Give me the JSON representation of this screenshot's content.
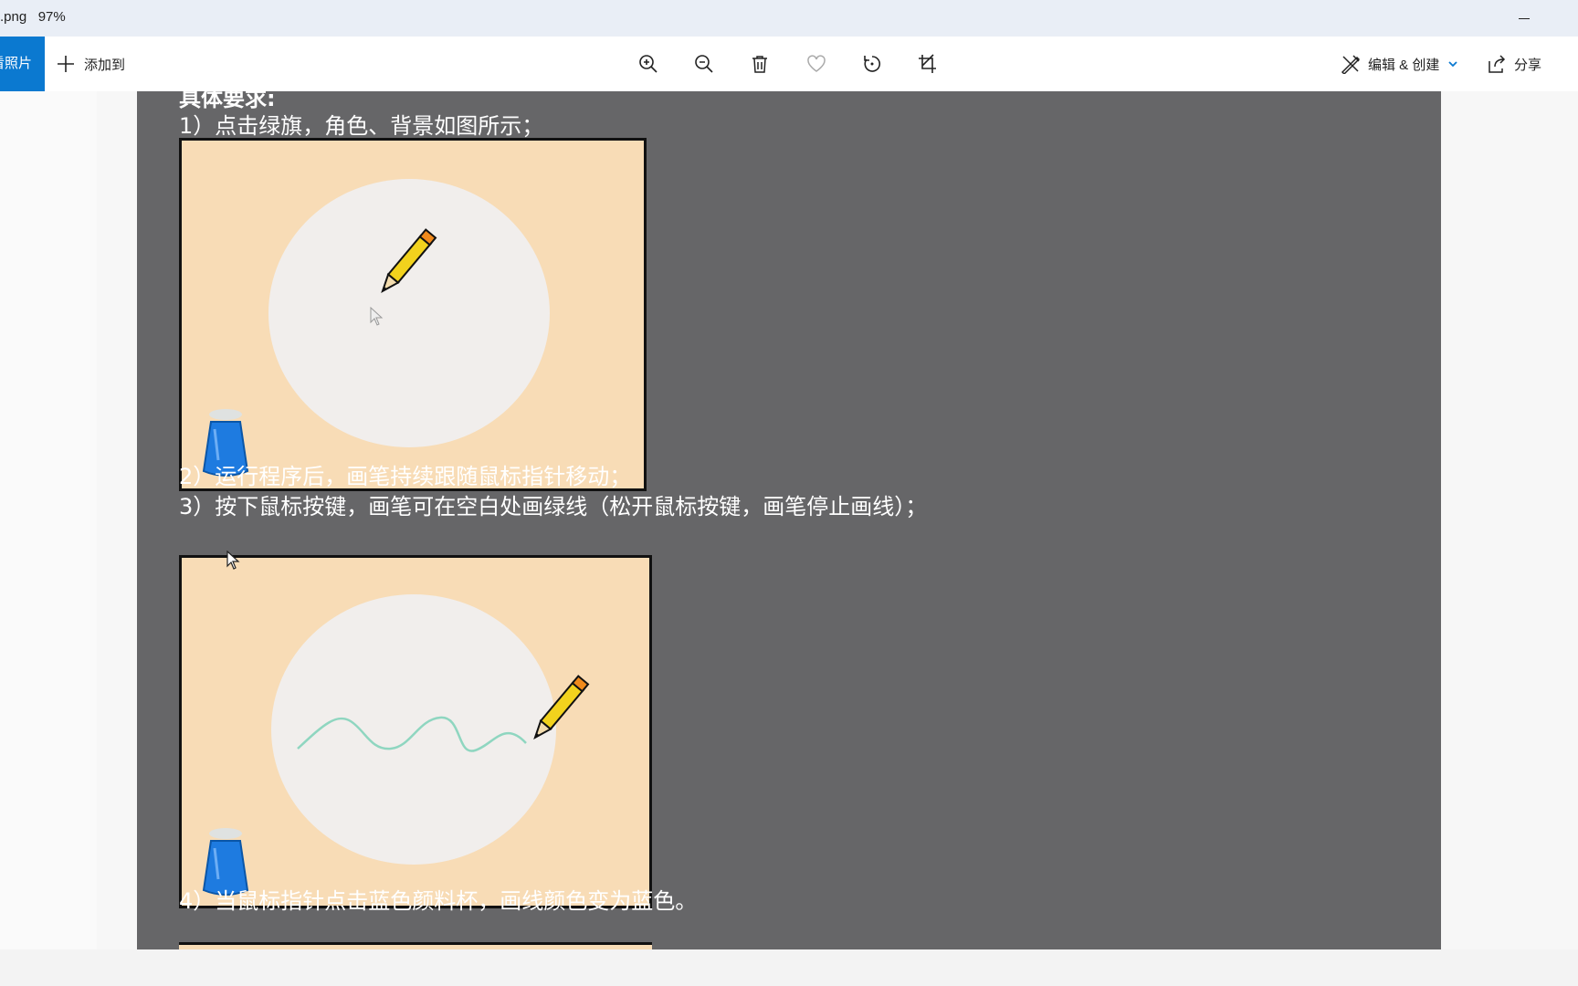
{
  "window": {
    "title": ".png   97%"
  },
  "toolbar": {
    "photos_label": "看照片",
    "add_to_label": "添加到",
    "edit_create_label": "编辑 & 创建",
    "share_label": "分享"
  },
  "document": {
    "heading_partial": "具体要求:",
    "req1": "1）点击绿旗，角色、背景如图所示；",
    "req2": "2）运行程序后，画笔持续跟随鼠标指针移动；",
    "req3": "3）按下鼠标按键，画笔可在空白处画绿线（松开鼠标按键，画笔停止画线）；",
    "req4": "4）当鼠标指针点击蓝色颜料杯，画线颜色变为蓝色。"
  },
  "colors": {
    "accent": "#0b79d0",
    "doc_background": "#666668",
    "stage_background": "#f8dcb6",
    "green_line": "#8fd6c0",
    "blue_cup": "#1e7be0",
    "pencil_yellow": "#f2d21d"
  },
  "icons": [
    "plus-icon",
    "zoom-in-icon",
    "zoom-out-icon",
    "delete-icon",
    "heart-icon",
    "rotate-icon",
    "crop-icon",
    "edit-create-icon",
    "chevron-down-icon",
    "share-icon",
    "pencil-sprite",
    "paint-cup-sprite",
    "mouse-cursor-icon"
  ]
}
